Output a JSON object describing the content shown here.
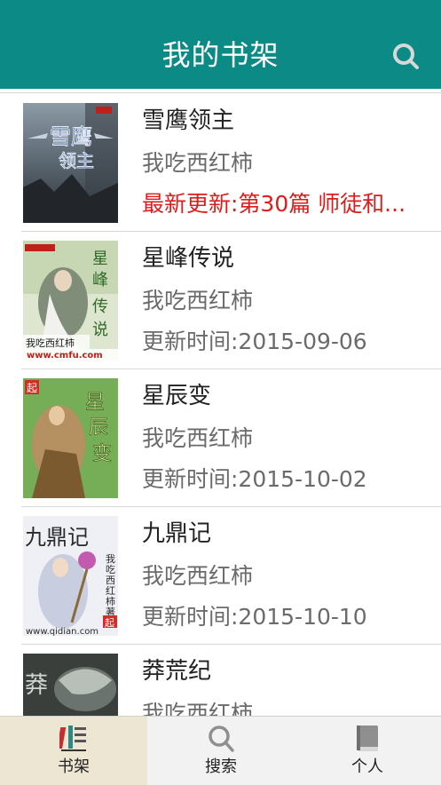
{
  "header": {
    "title": "我的书架",
    "search_icon": "search-icon"
  },
  "books": [
    {
      "title": "雪鹰领主",
      "author": "我吃西红柿",
      "update": "最新更新:第30篇 师徒和..."
    },
    {
      "title": "星峰传说",
      "author": "我吃西红柿",
      "update": "更新时间:2015-09-06"
    },
    {
      "title": "星辰变",
      "author": "我吃西红柿",
      "update": "更新时间:2015-10-02"
    },
    {
      "title": "九鼎记",
      "author": "我吃西红柿",
      "update": "更新时间:2015-10-10"
    },
    {
      "title": "莽荒纪",
      "author": "我吃西红柿",
      "update": ""
    }
  ],
  "covers": {
    "cover_1": {
      "lines": [
        "雪鹰",
        "领主"
      ]
    },
    "cover_2": {
      "lines": [
        "星",
        "峰",
        "传",
        "说"
      ],
      "author": "我吃西红柿",
      "url": "www.cmfu.com"
    },
    "cover_3": {
      "lines": [
        "星",
        "辰",
        "变"
      ],
      "badge": "起"
    },
    "cover_4": {
      "lines": [
        "九鼎记"
      ],
      "author_lines": [
        "我",
        "吃",
        "西",
        "红",
        "柿",
        "著"
      ],
      "badge": "起",
      "url": "www.qidian.com"
    },
    "cover_5": {
      "lines": [
        "莽"
      ]
    }
  },
  "tabs": [
    {
      "label": "书架",
      "icon": "bookshelf-icon",
      "active": true
    },
    {
      "label": "搜索",
      "icon": "search-icon",
      "active": false
    },
    {
      "label": "个人",
      "icon": "book-icon",
      "active": false
    }
  ],
  "colors": {
    "header": "#0b8a86",
    "latest_update": "#e01b1b",
    "active_tab": "#ece6d3"
  }
}
